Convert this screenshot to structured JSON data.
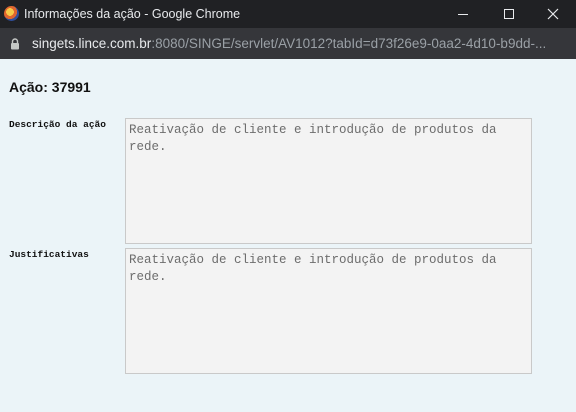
{
  "window": {
    "title": "Informações da ação - Google Chrome",
    "minimize_icon": "minimize-icon",
    "maximize_icon": "maximize-icon",
    "close_icon": "close-icon"
  },
  "address_bar": {
    "host": "singets.lince.com.br",
    "rest": ":8080/SINGE/servlet/AV1012?tabId=d73f26e9-0aa2-4d10-b9dd-...",
    "icon": "lock-icon"
  },
  "page": {
    "heading": "Ação: 37991",
    "description_label": "Descrição da ação",
    "description_value": "Reativação de cliente e introdução de produtos da rede.",
    "justification_label": "Justificativas",
    "justification_value": "Reativação de cliente e introdução de produtos da rede."
  },
  "colors": {
    "titlebar": "#202124",
    "urlbar": "#35363a",
    "page_background": "#ebf4f8",
    "field_background": "#f3f3f3"
  }
}
